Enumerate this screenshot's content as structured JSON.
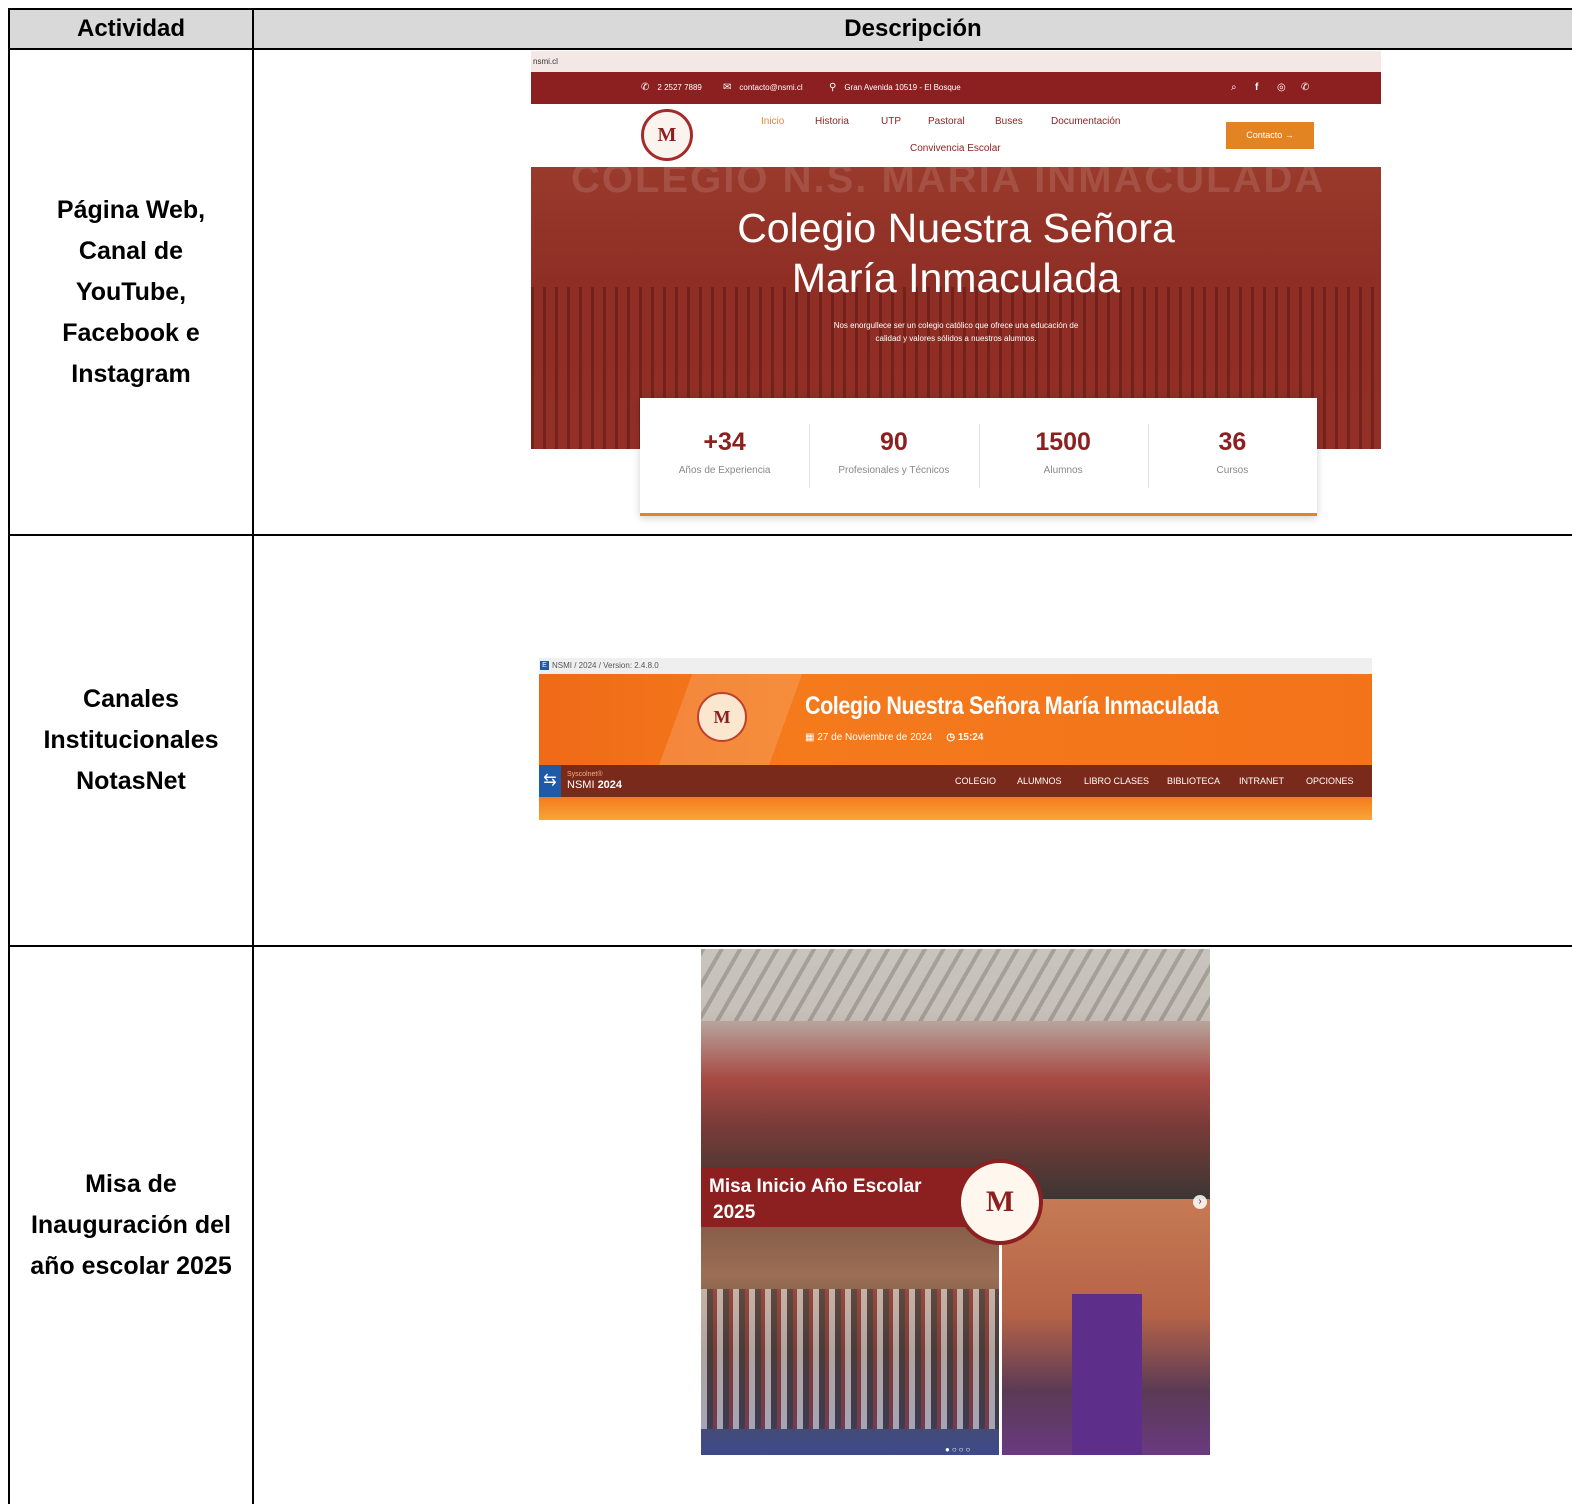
{
  "table": {
    "headers": [
      "Actividad",
      "Descripción"
    ],
    "rows": [
      {
        "actividad": "Página Web,\nCanal de\nYouTube,\nFacebook e\nInstagram"
      },
      {
        "actividad": "Canales\nInstitucionales\nNotasNet"
      },
      {
        "actividad": "Misa de\nInauguración del\naño escolar 2025"
      }
    ]
  },
  "website": {
    "url": "nsmi.cl",
    "phone": "2 2527 7889",
    "email": "contacto@nsmi.cl",
    "address": "Gran Avenida 10519 - El Bosque",
    "nav": [
      "Inicio",
      "Historia",
      "UTP",
      "Pastoral",
      "Buses",
      "Documentación",
      "Convivencia Escolar"
    ],
    "contact_button": "Contacto →",
    "hero_ghost": "COLEGIO N.S. MARIA INMACULADA",
    "hero_title_1": "Colegio Nuestra Señora",
    "hero_title_2": "María Inmaculada",
    "hero_sub_1": "Nos enorgullece ser un colegio católico que ofrece una educación de",
    "hero_sub_2": "calidad y valores sólidos a nuestros alumnos.",
    "stats": [
      {
        "value": "+34",
        "label": "Años de Experiencia"
      },
      {
        "value": "90",
        "label": "Profesionales y Técnicos"
      },
      {
        "value": "1500",
        "label": "Alumnos"
      },
      {
        "value": "36",
        "label": "Cursos"
      }
    ],
    "colors": {
      "primary": "#8c1f1f",
      "accent": "#e38423"
    }
  },
  "notasnet": {
    "version_bar": "NSMI / 2024 / Version: 2.4.8.0",
    "title": "Colegio Nuestra Señora María Inmaculada",
    "date": "27 de Noviembre de 2024",
    "time": "15:24",
    "brand_small": "Syscolnet®",
    "brand_code": "NSMI",
    "brand_year": "2024",
    "menu": [
      "COLEGIO",
      "ALUMNOS",
      "LIBRO CLASES",
      "BIBLIOTECA",
      "INTRANET",
      "OPCIONES"
    ],
    "colors": {
      "orange": "#f47a1c",
      "menu": "#7a2a1a"
    }
  },
  "photo": {
    "banner_line_1": "Misa Inicio Año Escolar",
    "banner_line_2": "2025"
  }
}
